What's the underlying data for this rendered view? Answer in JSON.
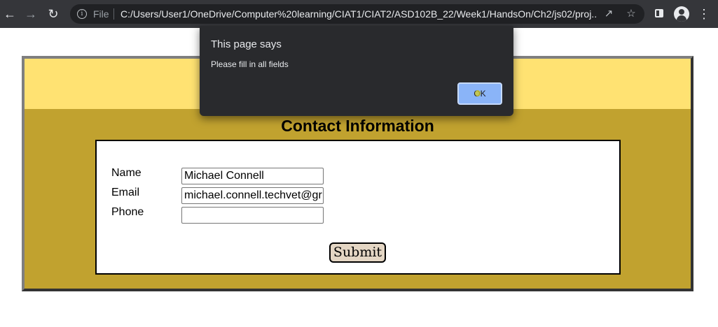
{
  "browser": {
    "scheme_label": "File",
    "url": "C:/Users/User1/OneDrive/Computer%20learning/CIAT1/CIAT2/ASD102B_22/Week1/HandsOn/Ch2/js02/proj...",
    "icons": {
      "back": "arrow-left-icon",
      "forward": "arrow-right-icon",
      "reload": "reload-icon",
      "info": "info-icon",
      "share": "share-icon",
      "bookmark": "star-icon",
      "side_panel": "side-panel-icon",
      "profile": "profile-icon",
      "menu": "kebab-menu-icon"
    }
  },
  "page": {
    "heading": "Contact Information",
    "form": {
      "name_label": "Name",
      "name_value": "Michael Connell",
      "email_label": "Email",
      "email_value": "michael.connell.techvet@gr",
      "phone_label": "Phone",
      "phone_value": "",
      "submit_label": "Submit"
    },
    "colors": {
      "banner": "#ffe272",
      "body": "#c1a22f",
      "submit": "#e4d6c4"
    }
  },
  "dialog": {
    "title": "This page says",
    "message": "Please fill in all fields",
    "ok_label": "OK"
  }
}
